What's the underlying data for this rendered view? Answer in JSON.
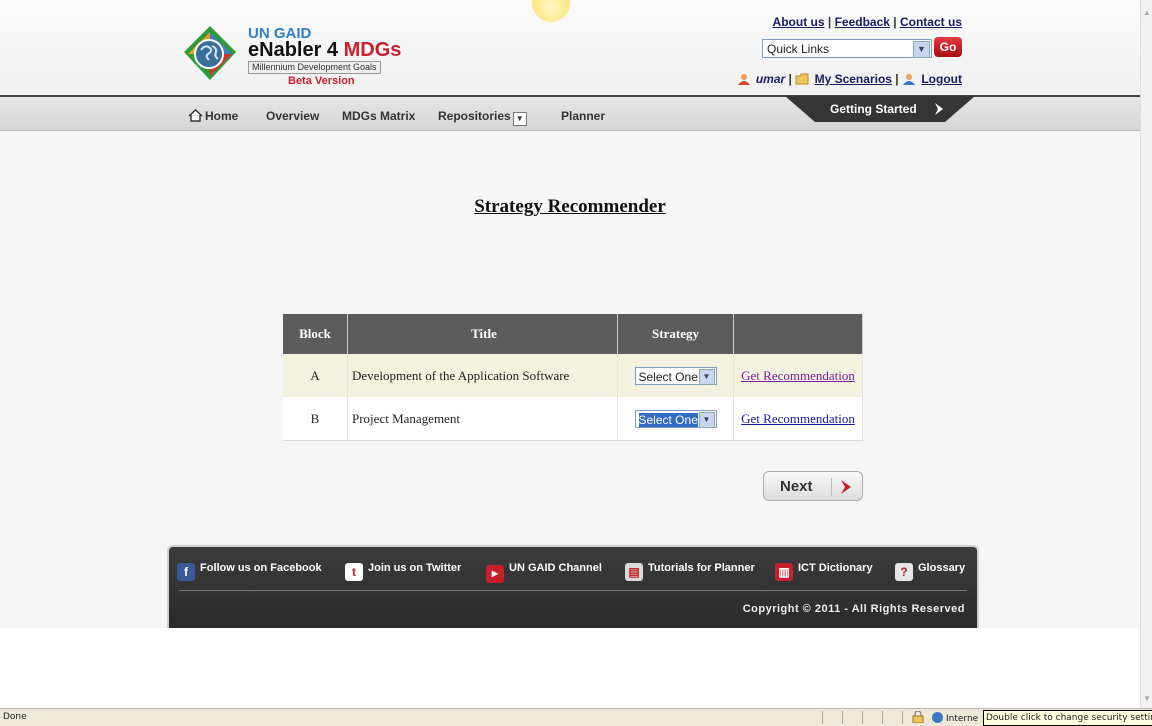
{
  "header": {
    "logo": {
      "line1": "UN GAID",
      "line2_main": "eNabler 4 ",
      "line2_accent": "MDGs",
      "line3": "Millennium Development Goals",
      "beta": "Beta Version"
    },
    "top_links": [
      "About us",
      "Feedback",
      "Contact us"
    ],
    "quick_links": {
      "selected": "Quick Links",
      "go_label": "Go"
    },
    "user": {
      "name": "umar",
      "my_scenarios": "My Scenarios",
      "logout": "Logout"
    }
  },
  "nav": {
    "home": "Home",
    "overview": "Overview",
    "matrix": "MDGs Matrix",
    "repositories": "Repositories",
    "planner": "Planner",
    "getting_started": "Getting Started"
  },
  "main": {
    "title": "Strategy Recommender",
    "table": {
      "headers": [
        "Block",
        "Title",
        "Strategy",
        ""
      ],
      "rows": [
        {
          "block": "A",
          "title": "Development of the Application Software",
          "strategy": "Select One",
          "action": "Get Recommendation"
        },
        {
          "block": "B",
          "title": "Project Management",
          "strategy": "Select One",
          "action": "Get Recommendation"
        }
      ]
    },
    "next_label": "Next"
  },
  "footer": {
    "links": [
      "Follow us on Facebook",
      "Join us on Twitter",
      "UN GAID Channel",
      "Tutorials for Planner",
      "ICT Dictionary",
      "Glossary"
    ],
    "copyright": "Copyright © 2011 - All Rights Reserved"
  },
  "status": {
    "left": "Done",
    "zone": "Interne",
    "tooltip": "Double click to change security settings"
  },
  "colors": {
    "accent_red": "#c8202a",
    "nav_dark": "#333333",
    "table_header": "#5c5c5c"
  }
}
